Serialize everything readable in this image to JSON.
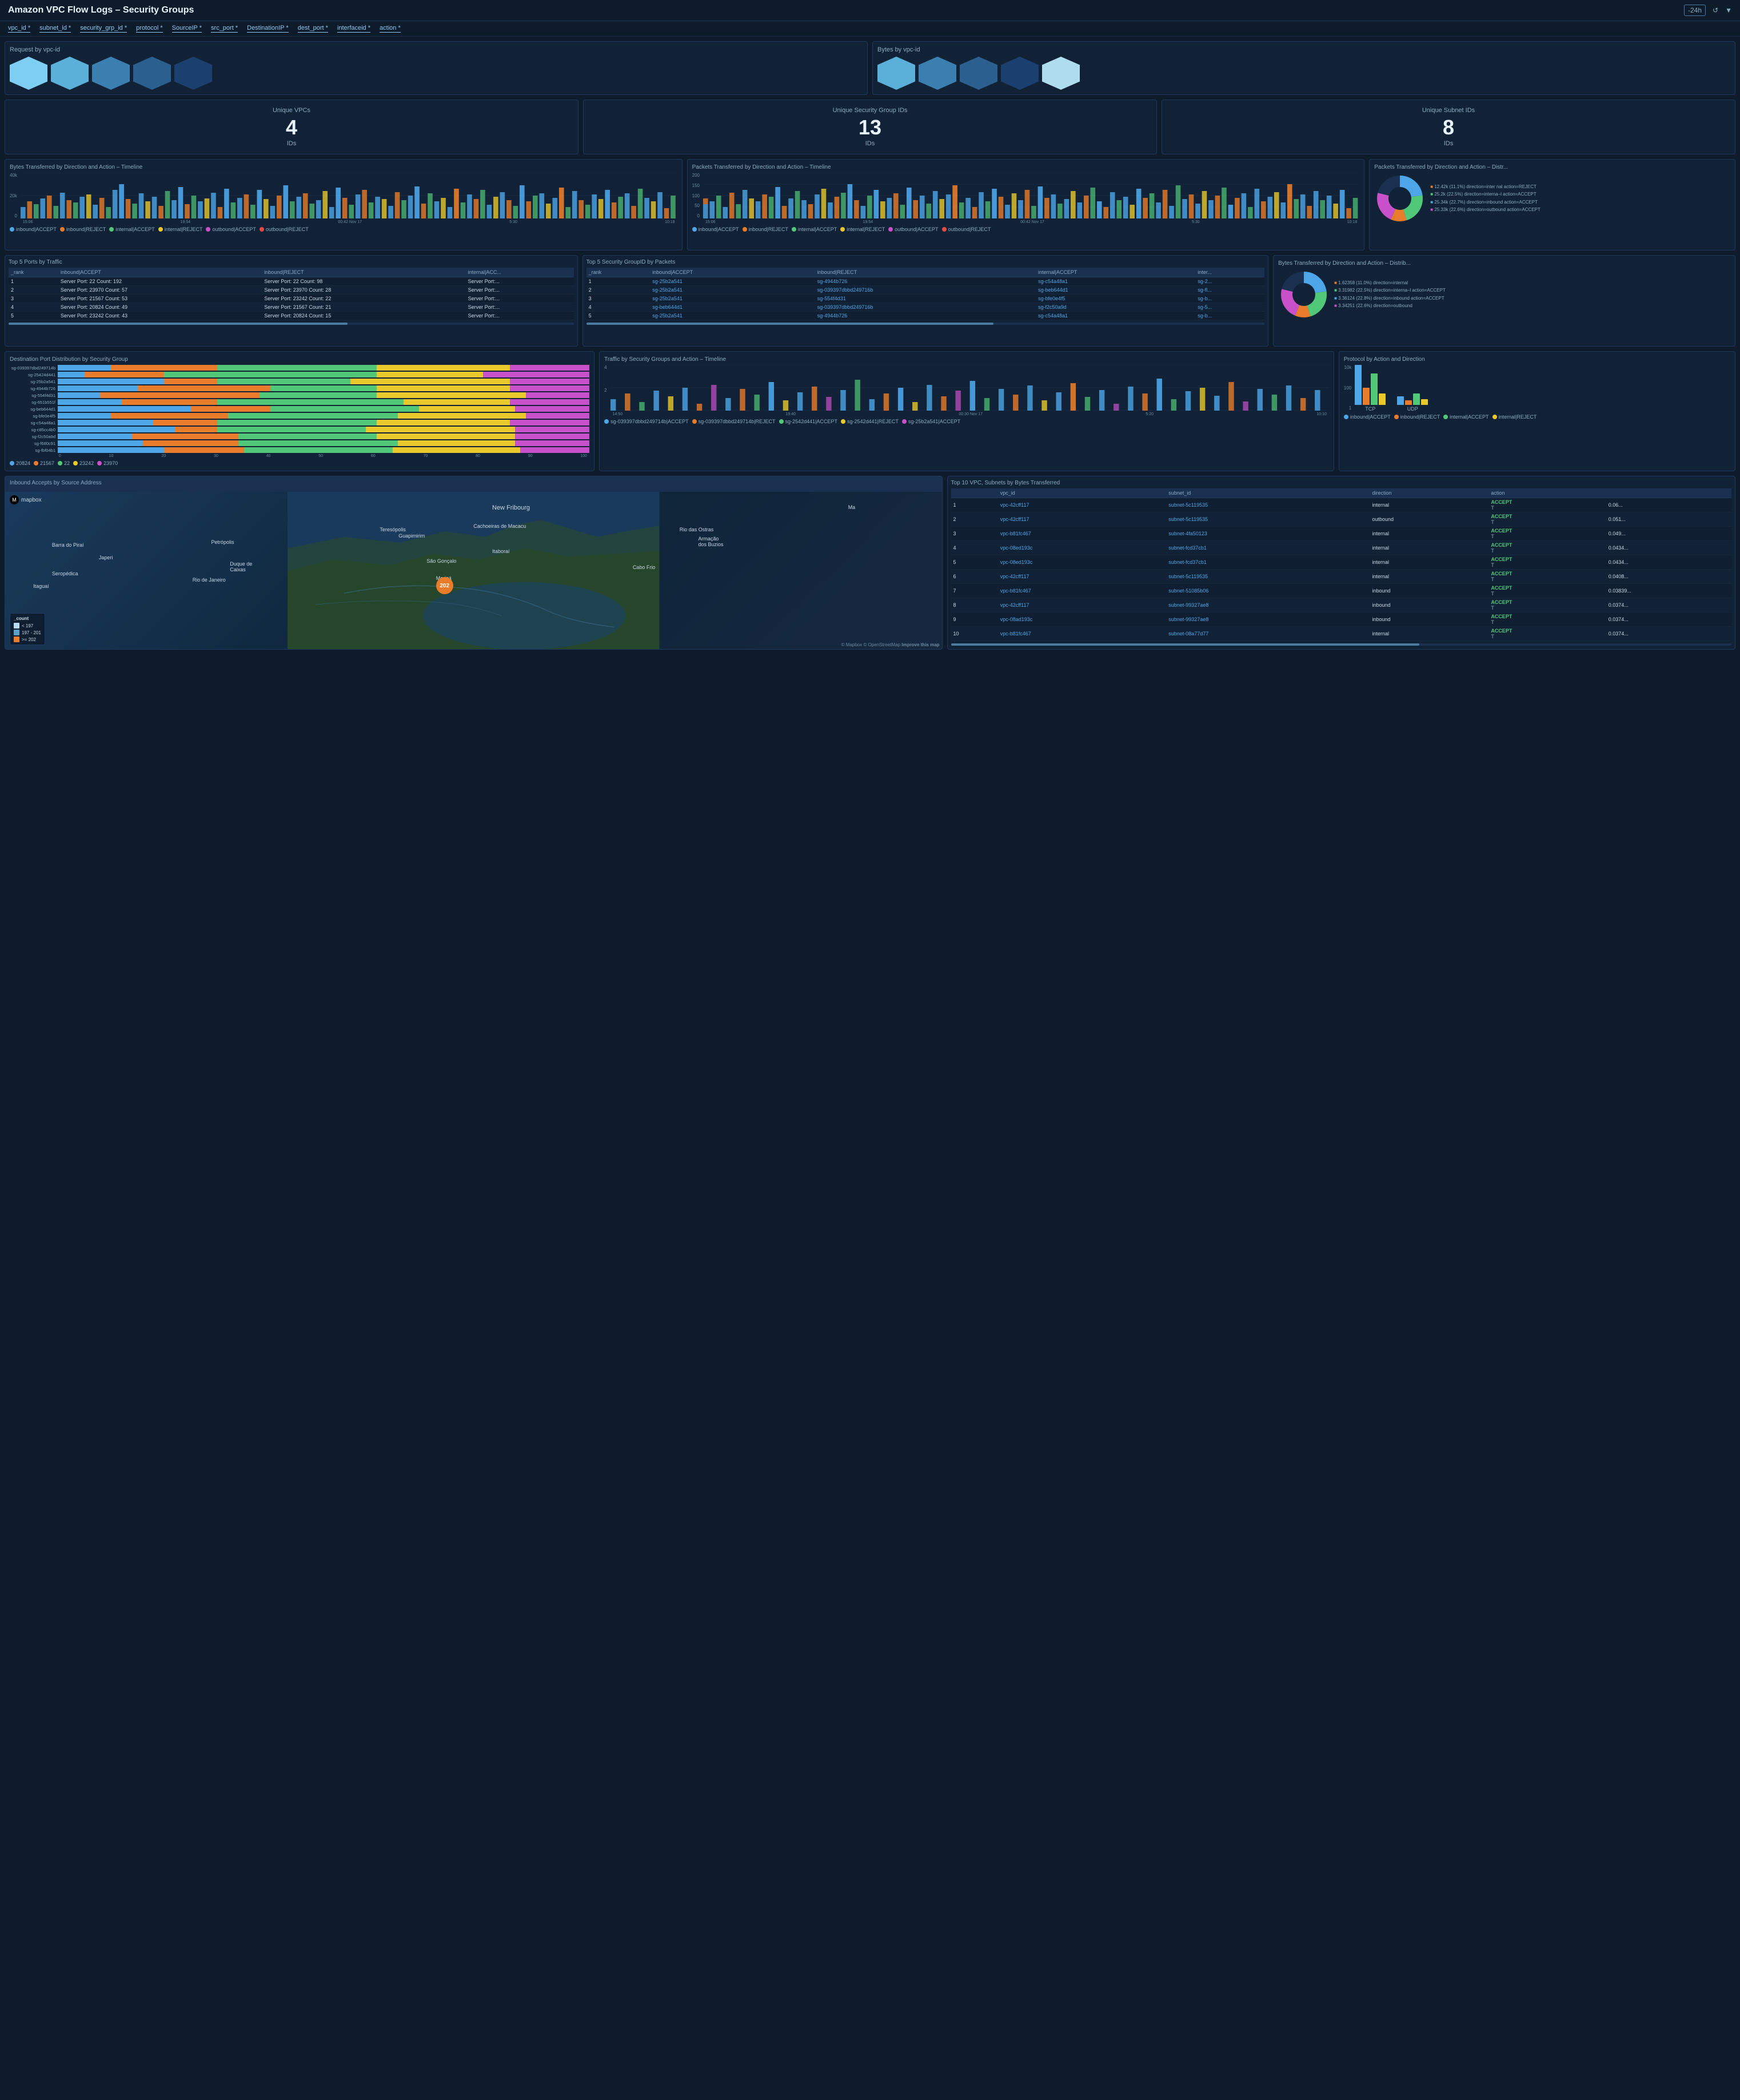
{
  "header": {
    "title": "Amazon VPC Flow Logs – Security Groups",
    "time_control": "-24h",
    "filter_icon": "filter"
  },
  "filters": [
    "vpc_id",
    "subnet_id",
    "security_grp_id",
    "protocol",
    "SourceIP",
    "src_port",
    "DestinationIP",
    "dest_port",
    "interfaceid",
    "action"
  ],
  "request_by_vpc": {
    "title": "Request by vpc-id",
    "hexagons": [
      {
        "color": "#7ecef4",
        "intensity": 0.9
      },
      {
        "color": "#5ab0d8",
        "intensity": 0.6
      },
      {
        "color": "#3a8ab8",
        "intensity": 0.5
      },
      {
        "color": "#2a6a98",
        "intensity": 0.4
      },
      {
        "color": "#1a4a78",
        "intensity": 0.3
      }
    ]
  },
  "bytes_by_vpc": {
    "title": "Bytes by vpc-id",
    "hexagons": [
      {
        "color": "#5ab0d8",
        "intensity": 0.6
      },
      {
        "color": "#3a8ab8",
        "intensity": 0.5
      },
      {
        "color": "#2a6a98",
        "intensity": 0.4
      },
      {
        "color": "#1a4a78",
        "intensity": 0.3
      },
      {
        "color": "#b8e4f8",
        "intensity": 0.8
      }
    ]
  },
  "stats": {
    "unique_vpcs": {
      "title": "Unique VPCs",
      "value": "4",
      "label": "IDs"
    },
    "unique_sg_ids": {
      "title": "Unique Security Group IDs",
      "value": "13",
      "label": "IDs"
    },
    "unique_subnet_ids": {
      "title": "Unique Subnet IDs",
      "value": "8",
      "label": "IDs"
    }
  },
  "bytes_timeline": {
    "title": "Bytes Transferred by Direction and Action – Timeline",
    "y_labels": [
      "40k",
      "20k",
      "0"
    ],
    "x_labels": [
      "15:06",
      "19:54",
      "00:42 Nov 17",
      "5:30",
      "10:18"
    ],
    "legend": [
      {
        "label": "inbound|ACCEPT",
        "color": "#4da6e8"
      },
      {
        "label": "inbound|REJECT",
        "color": "#e87c2a"
      },
      {
        "label": "internal|ACCEPT",
        "color": "#50c878"
      },
      {
        "label": "internal|REJECT",
        "color": "#e8c82a"
      },
      {
        "label": "outbound|ACCEPT",
        "color": "#c850c8"
      },
      {
        "label": "outbound|REJECT",
        "color": "#e84a4a"
      }
    ]
  },
  "packets_timeline": {
    "title": "Packets Transferred by Direction and Action – Timeline",
    "y_labels": [
      "200",
      "150",
      "100",
      "50",
      "0"
    ],
    "x_labels": [
      "15:06",
      "19:54",
      "00:42 Nov 17",
      "5:30",
      "10:18"
    ],
    "legend": [
      {
        "label": "inbound|ACCEPT",
        "color": "#4da6e8"
      },
      {
        "label": "inbound|REJECT",
        "color": "#e87c2a"
      },
      {
        "label": "internal|ACCEPT",
        "color": "#50c878"
      },
      {
        "label": "internal|REJECT",
        "color": "#e8c82a"
      },
      {
        "label": "outbound|ACCEPT",
        "color": "#c850c8"
      },
      {
        "label": "outbound|REJECT",
        "color": "#e84a4a"
      }
    ]
  },
  "packets_dist": {
    "title": "Packets Transferred by Direction and Action – Distr...",
    "segments": [
      {
        "label": "12.42k (11.1%) direction=internal action=REJECT",
        "color": "#e87c2a",
        "pct": 11.1
      },
      {
        "label": "25.2k (22.5%) direction=internal action=ACCEPT",
        "color": "#50c878",
        "pct": 22.5
      },
      {
        "label": "25.34k (22.7%) direction=inbound action=ACCEPT",
        "color": "#4da6e8",
        "pct": 22.7
      },
      {
        "label": "25.33k (22.6%) direction=outbound action=ACCEPT",
        "color": "#c850c8",
        "pct": 22.6
      }
    ]
  },
  "top5_ports": {
    "title": "Top 5 Ports by Traffic",
    "columns": [
      "_rank",
      "inbound|ACCEPT",
      "inbound|REJECT",
      "internal|ACC..."
    ],
    "rows": [
      [
        "1",
        "Server Port: 22 Count: 192",
        "Server Port: 22 Count: 98",
        "Server Port:..."
      ],
      [
        "2",
        "Server Port: 23970 Count: 57",
        "Server Port: 23970 Count: 28",
        "Server Port:..."
      ],
      [
        "3",
        "Server Port: 21567 Count: 53",
        "Server Port: 23242 Count: 22",
        "Server Port:..."
      ],
      [
        "4",
        "Server Port: 20824 Count: 49",
        "Server Port: 21567 Count: 21",
        "Server Port:..."
      ],
      [
        "5",
        "Server Port: 23242 Count: 43",
        "Server Port: 20824 Count: 15",
        "Server Port:..."
      ]
    ]
  },
  "top5_sg": {
    "title": "Top 5 Security GroupID by Packets",
    "columns": [
      "_rank",
      "inbound|ACCEPT",
      "inbound|REJECT",
      "internal|ACCEPT",
      "inter..."
    ],
    "rows": [
      [
        "1",
        "sg-25b2a541",
        "sg-4944b726",
        "sg-c54a48a1",
        "sg-2..."
      ],
      [
        "2",
        "sg-25b2a541",
        "sg-039397dbbd249716b",
        "sg-beb644d1",
        "sg-fl..."
      ],
      [
        "3",
        "sg-25b2a541",
        "sg-554f4d31",
        "sg-bfe0e4f5",
        "sg-b..."
      ],
      [
        "4",
        "sg-beb644d1",
        "sg-039397dbbd249716b",
        "sg-f2c50a9d",
        "sg-5..."
      ],
      [
        "5",
        "sg-25b2a541",
        "sg-4944b726",
        "sg-c54a48a1",
        "sg-b..."
      ]
    ]
  },
  "bytes_dist": {
    "title": "Bytes Transferred by Direction and Action – Distrib...",
    "segments": [
      {
        "label": "1.62358 (11.0%) direction=internal",
        "color": "#e87c2a",
        "pct": 11
      },
      {
        "label": "3.31982 (22.5%) direction=interna– l action=ACCEPT",
        "color": "#50c878",
        "pct": 22.5
      },
      {
        "label": "3.36124 (22.8%) direction=inbound action=ACCEPT",
        "color": "#4da6e8",
        "pct": 22.8
      },
      {
        "label": "3.34251 (22.6%) direction=outbound",
        "color": "#c850c8",
        "pct": 22.6
      }
    ]
  },
  "dest_port_dist": {
    "title": "Destination Port Distribution by Security Group",
    "labels": [
      "sg-039397dbd249714b",
      "sg-25424d441",
      "sg-25b2a541",
      "sg-4944b726",
      "sg-554f4d31",
      "sg-651b551f",
      "sg-beb644d1",
      "sg-bfe0e4f5",
      "sg-c54a48a1",
      "sg-c85cc4b0",
      "sg-f2c50a9d",
      "sg-f680c91",
      "sg-fbf04b1"
    ],
    "legend": [
      {
        "value": "20824",
        "color": "#4da6e8"
      },
      {
        "value": "21567",
        "color": "#e87c2a"
      },
      {
        "value": "22",
        "color": "#50c878"
      },
      {
        "value": "23242",
        "color": "#e8c82a"
      },
      {
        "value": "23970",
        "color": "#c850c8"
      }
    ],
    "x_labels": [
      "0",
      "10",
      "20",
      "30",
      "40",
      "50",
      "60",
      "70",
      "80",
      "90",
      "100"
    ]
  },
  "traffic_sg_timeline": {
    "title": "Traffic by Security Groups and Action – Timeline",
    "y_labels": [
      "4",
      "2",
      ""
    ],
    "x_labels": [
      "14:50",
      "19:40",
      "00:30 Nov 17",
      "5:20",
      "10:10"
    ],
    "legend": [
      {
        "label": "sg-039397dbbd249714b|ACCEPT",
        "color": "#4da6e8"
      },
      {
        "label": "sg-039397dbbd249714b|REJECT",
        "color": "#e87c2a"
      },
      {
        "label": "sg-2542d441|ACCEPT",
        "color": "#50c878"
      },
      {
        "label": "sg-2542d441|REJECT",
        "color": "#e8c82a"
      },
      {
        "label": "sg-25b2a541|ACCEPT",
        "color": "#c850c8"
      }
    ]
  },
  "protocol_chart": {
    "title": "Protocol by Action and Direction",
    "y_labels": [
      "10k",
      "100",
      "1"
    ],
    "bars": [
      {
        "label": "TCP",
        "segments": [
          {
            "color": "#4da6e8",
            "height": 70
          },
          {
            "color": "#e87c2a",
            "height": 30
          },
          {
            "color": "#50c878",
            "height": 55
          },
          {
            "color": "#e8c82a",
            "height": 20
          }
        ]
      },
      {
        "label": "UDP",
        "segments": [
          {
            "color": "#4da6e8",
            "height": 15
          },
          {
            "color": "#e87c2a",
            "height": 8
          },
          {
            "color": "#50c878",
            "height": 20
          },
          {
            "color": "#e8c82a",
            "height": 10
          }
        ]
      }
    ],
    "legend": [
      {
        "label": "inbound|ACCEPT",
        "color": "#4da6e8"
      },
      {
        "label": "inbound|REJECT",
        "color": "#e87c2a"
      },
      {
        "label": "internal|ACCEPT",
        "color": "#50c878"
      },
      {
        "label": "internal|REJECT",
        "color": "#e8c82a"
      }
    ]
  },
  "map": {
    "title": "Inbound Accepts by Source Address",
    "mapbox_label": "mapbox",
    "location_label": "New Fribourg",
    "city_labels": [
      {
        "name": "Teresópolis",
        "top": "22%",
        "left": "38%"
      },
      {
        "name": "Barra do Piraí",
        "top": "32%",
        "left": "10%"
      },
      {
        "name": "Petrópolis",
        "top": "30%",
        "left": "25%"
      },
      {
        "name": "Guapimirim",
        "top": "28%",
        "left": "40%"
      },
      {
        "name": "Cachoeiras de Macacu",
        "top": "22%",
        "left": "50%"
      },
      {
        "name": "Rio das Ostras",
        "top": "26%",
        "left": "72%"
      },
      {
        "name": "Japeri",
        "top": "42%",
        "left": "12%"
      },
      {
        "name": "Seropédica",
        "top": "52%",
        "left": "8%"
      },
      {
        "name": "Duque de Caixas",
        "top": "45%",
        "left": "28%"
      },
      {
        "name": "São Gonçalo",
        "top": "43%",
        "left": "47%"
      },
      {
        "name": "Itaboraí",
        "top": "38%",
        "left": "53%"
      },
      {
        "name": "Armação dos Buzios",
        "top": "30%",
        "left": "76%"
      },
      {
        "name": "Itaguaí",
        "top": "60%",
        "left": "6%"
      },
      {
        "name": "Rio de Janeiro",
        "top": "55%",
        "left": "24%"
      },
      {
        "name": "Maricá",
        "top": "55%",
        "left": "48%"
      },
      {
        "name": "Cabo Frio",
        "top": "48%",
        "left": "68%"
      }
    ],
    "dot": {
      "value": "202",
      "top": "57%",
      "left": "48%"
    },
    "legend": {
      "title": "_count",
      "items": [
        {
          "label": "< 197",
          "color": "#c8e6f8"
        },
        {
          "label": "197 - 201",
          "color": "#6ab4d8"
        },
        {
          "label": "> 202",
          "color": "#e87c2a"
        }
      ]
    },
    "credit": "© Mapbox © OpenStreetMap  Improve this map"
  },
  "top10_table": {
    "title": "Top 10 VPC, Subnets by Bytes Transferred",
    "columns": [
      "",
      "vpc_id",
      "subnet_id",
      "direction",
      "action",
      ""
    ],
    "rows": [
      {
        "rank": "1",
        "vpc_id": "vpc-42cff117",
        "subnet_id": "subnet-5c119535",
        "direction": "internal",
        "action": "ACCEPT",
        "value": "0.06..."
      },
      {
        "rank": "2",
        "vpc_id": "vpc-42cff117",
        "subnet_id": "subnet-5c119535",
        "direction": "outbound",
        "action": "ACCEPT",
        "value": "0.051..."
      },
      {
        "rank": "3",
        "vpc_id": "vpc-b81fc467",
        "subnet_id": "subnet-4fa50123",
        "direction": "internal",
        "action": "ACCEPT",
        "value": "0.049..."
      },
      {
        "rank": "4",
        "vpc_id": "vpc-08ed193c",
        "subnet_id": "subnet-fcd37cb1",
        "direction": "internal",
        "action": "ACCEPT",
        "value": "0.0434..."
      },
      {
        "rank": "5",
        "vpc_id": "vpc-08ed193c",
        "subnet_id": "subnet-fcd37cb1",
        "direction": "internal",
        "action": "ACCEPT",
        "value": "0.0434..."
      },
      {
        "rank": "6",
        "vpc_id": "vpc-42cff117",
        "subnet_id": "subnet-5c119535",
        "direction": "internal",
        "action": "ACCEPT",
        "value": "0.0408..."
      },
      {
        "rank": "7",
        "vpc_id": "vpc-b81fc467",
        "subnet_id": "subnet-51085b06",
        "direction": "inbound",
        "action": "ACCEPT",
        "value": "0.03839..."
      },
      {
        "rank": "8",
        "vpc_id": "vpc-42cff117",
        "subnet_id": "subnet-99327ae8",
        "direction": "inbound",
        "action": "ACCEPT",
        "value": "0.0374..."
      },
      {
        "rank": "9",
        "vpc_id": "vpc-08ad193c",
        "subnet_id": "subnet-99327ae8",
        "direction": "inbound",
        "action": "ACCEPT",
        "value": "0.0374..."
      },
      {
        "rank": "10",
        "vpc_id": "vpc-b81fc467",
        "subnet_id": "subnet-08a77d77",
        "direction": "internal",
        "action": "ACCEPT",
        "value": "0.0374..."
      }
    ]
  }
}
